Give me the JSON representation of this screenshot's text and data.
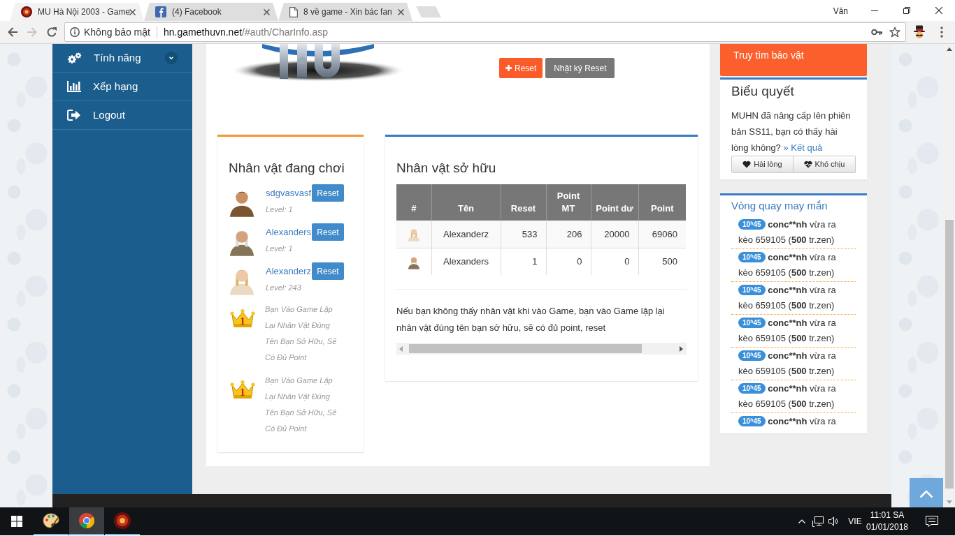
{
  "browser": {
    "tabs": [
      {
        "title": "MU Hà Nội 2003 - Game",
        "kind": "game",
        "selected": true
      },
      {
        "title": "(4) Facebook",
        "kind": "social",
        "selected": false
      },
      {
        "title": "8 về game - Xin bác fan",
        "kind": "page",
        "selected": false
      }
    ],
    "profile": "Văn",
    "address": {
      "security": "Không bảo mật",
      "host": "hn.gamethuvn.net",
      "path": "/#auth/CharInfo.asp"
    }
  },
  "sidebar": {
    "items": [
      {
        "label": "Tính năng",
        "has_submenu": true
      },
      {
        "label": "Xếp hạng",
        "has_submenu": false
      },
      {
        "label": "Logout",
        "has_submenu": false
      }
    ]
  },
  "header": {
    "buttons": [
      {
        "label": "Reset",
        "kind": "add"
      },
      {
        "label": "Nhật ký Reset",
        "kind": "plain"
      }
    ]
  },
  "playing": {
    "title": "Nhân vật đang chơi",
    "characters": [
      {
        "name": "sdgvasvasf",
        "kind": "knight",
        "button": "Reset",
        "level": "Level: 1"
      },
      {
        "name": "Alexanders",
        "kind": "wizard",
        "button": "Reset",
        "level": "Level: 1"
      },
      {
        "name": "Alexanderz",
        "kind": "elf",
        "button": "Reset",
        "level": "Level: 243"
      }
    ],
    "notices": [
      {
        "rank": "1",
        "text": "Bạn Vào Game Lập Lại Nhân Vật Đúng Tên Bạn Sở Hữu, Sẽ Có Đủ Point"
      },
      {
        "rank": "1",
        "text": "Bạn Vào Game Lập Lại Nhân Vật Đúng Tên Bạn Sở Hữu, Sẽ Có Đủ Point"
      }
    ]
  },
  "owned": {
    "title": "Nhân vật sở hữu",
    "table": {
      "columns": [
        "#",
        "Tên",
        "Reset",
        "Point MT",
        "Point dư",
        "Point"
      ],
      "rows": [
        {
          "kind": "elf",
          "cells": [
            "",
            "Alexanderz",
            "533",
            "206",
            "20000",
            "69060"
          ]
        },
        {
          "kind": "wizard",
          "cells": [
            "",
            "Alexanders",
            "1",
            "0",
            "0",
            "500"
          ]
        }
      ]
    },
    "note": "Nếu bạn không thấy nhân vật khi vào Game, bạn vào Game lập lại nhân vật đúng tên bạn sở hữu, sẽ có đủ point, reset"
  },
  "treasure": {
    "label": "Truy tìm bảo vật"
  },
  "poll": {
    "title": "Biểu quyết",
    "question": "MUHN đã nâng cấp lên phiên bản SS11, bạn có thấy hài lòng không?",
    "results_link": "» Kết quả",
    "options": [
      "Hài lòng",
      "Khó chịu"
    ]
  },
  "lucky_wheel": {
    "title": "Vòng quay may mắn",
    "entries": [
      {
        "time": "10$^{h}$45",
        "user": "conc**nh",
        "action": "vừa ra",
        "detail": "kèo 659105 (**500** tr.zen)"
      },
      {
        "time": "10$^{h}$45",
        "user": "conc**nh",
        "action": "vừa ra",
        "detail": "kèo 659105 (**500** tr.zen)"
      },
      {
        "time": "10$^{h}$45",
        "user": "conc**nh",
        "action": "vừa ra",
        "detail": "kèo 659105 (**500** tr.zen)"
      },
      {
        "time": "10$^{h}$45",
        "user": "conc**nh",
        "action": "vừa ra",
        "detail": "kèo 659105 (**500** tr.zen)"
      },
      {
        "time": "10$^{h}$45",
        "user": "conc**nh",
        "action": "vừa ra",
        "detail": "kèo 659105 (**500** tr.zen)"
      },
      {
        "time": "10$^{h}$45",
        "user": "conc**nh",
        "action": "vừa ra",
        "detail": "kèo 659105 (**500** tr.zen)"
      },
      {
        "time": "10$^{h}$45",
        "user": "conc**nh",
        "action": "vừa ra"
      }
    ]
  },
  "taskbar": {
    "apps": [
      {
        "kind": "paint",
        "selected": false
      },
      {
        "kind": "browser",
        "selected": true
      },
      {
        "kind": "game",
        "selected": false
      }
    ],
    "language": "VIE",
    "time": "11:01 SA",
    "date": "01/01/2018"
  }
}
